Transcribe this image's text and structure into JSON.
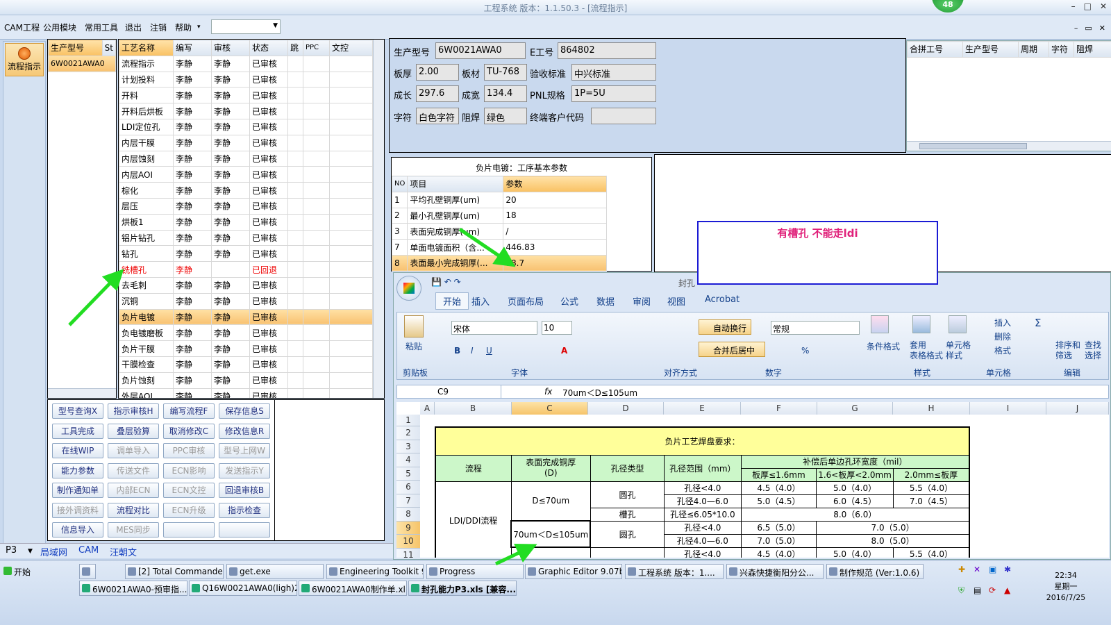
{
  "window": {
    "title": "工程系统  版本：1.1.50.3 - [流程指示]",
    "badge": "48",
    "min": "–",
    "max": "□",
    "close": "✕"
  },
  "menu": {
    "items": [
      "CAM工程",
      "公用模块",
      "常用工具",
      "退出",
      "注销",
      "帮助"
    ],
    "help_arrow": "▾"
  },
  "nav": {
    "button_label": "流程指示"
  },
  "model_list": {
    "headers": [
      "生产型号",
      "St"
    ],
    "rows": [
      "6W0021AWA0"
    ]
  },
  "process_grid": {
    "headers": [
      "工艺名称",
      "编写",
      "审核",
      "状态",
      "跳",
      "PPC",
      "文控"
    ],
    "rows": [
      [
        "流程指示",
        "李静",
        "李静",
        "已审核"
      ],
      [
        "计划投料",
        "李静",
        "李静",
        "已审核"
      ],
      [
        "开料",
        "李静",
        "李静",
        "已审核"
      ],
      [
        "开料后烘板",
        "李静",
        "李静",
        "已审核"
      ],
      [
        "LDI定位孔",
        "李静",
        "李静",
        "已审核"
      ],
      [
        "内层干膜",
        "李静",
        "李静",
        "已审核"
      ],
      [
        "内层蚀刻",
        "李静",
        "李静",
        "已审核"
      ],
      [
        "内层AOI",
        "李静",
        "李静",
        "已审核"
      ],
      [
        "棕化",
        "李静",
        "李静",
        "已审核"
      ],
      [
        "层压",
        "李静",
        "李静",
        "已审核"
      ],
      [
        "烘板1",
        "李静",
        "李静",
        "已审核"
      ],
      [
        "铝片钻孔",
        "李静",
        "李静",
        "已审核"
      ],
      [
        "钻孔",
        "李静",
        "李静",
        "已审核"
      ],
      [
        "铣槽孔",
        "李静",
        "",
        "已回退"
      ],
      [
        "去毛刺",
        "李静",
        "李静",
        "已审核"
      ],
      [
        "沉铜",
        "李静",
        "李静",
        "已审核"
      ],
      [
        "负片电镀",
        "李静",
        "李静",
        "已审核"
      ],
      [
        "负电镀磨板",
        "李静",
        "李静",
        "已审核"
      ],
      [
        "负片干膜",
        "李静",
        "李静",
        "已审核"
      ],
      [
        "干膜检查",
        "李静",
        "李静",
        "已审核"
      ],
      [
        "负片蚀刻",
        "李静",
        "李静",
        "已审核"
      ],
      [
        "外层AOI",
        "李静",
        "李静",
        "已审核"
      ]
    ]
  },
  "buttons": [
    [
      "型号查询X",
      "指示审核H",
      "编写流程F",
      "保存信息S"
    ],
    [
      "工具完成",
      "叠层验算",
      "取消修改C",
      "修改信息R"
    ],
    [
      "在线WIP",
      "调单导入",
      "PPC审核",
      "型号上网W"
    ],
    [
      "能力参数",
      "传送文件",
      "ECN影响",
      "发送指示Y"
    ],
    [
      "制作通知单",
      "内部ECN",
      "ECN文控",
      "回退审核B"
    ],
    [
      "接外调资料",
      "流程对比",
      "ECN升级",
      "指示检查"
    ],
    [
      "信息导入",
      "MES同步",
      "",
      ""
    ]
  ],
  "bottom_tabs": {
    "combo": "P3",
    "tabs": [
      "局域网",
      "CAM",
      "汪朝文"
    ]
  },
  "info": {
    "labels": [
      "生产型号",
      "E工号",
      "板厚",
      "板材",
      "验收标准",
      "成长",
      "成宽",
      "PNL规格",
      "字符",
      "阻焊",
      "终端客户代码"
    ],
    "values": [
      "6W0021AWA0",
      "864802",
      "2.00",
      "TU-768",
      "中兴标准",
      "297.6",
      "134.4",
      "1P=5U",
      "白色字符",
      "绿色",
      ""
    ]
  },
  "merge_grid": {
    "headers": [
      "合拼工号",
      "生产型号",
      "周期",
      "字符",
      "阻焊"
    ]
  },
  "params": {
    "title": "负片电镀：工序基本参数",
    "headers": [
      "NO",
      "项目",
      "参数"
    ],
    "rows": [
      [
        "1",
        "平均孔壁铜厚(um)",
        "20"
      ],
      [
        "2",
        "最小孔壁铜厚(um)",
        "18"
      ],
      [
        "3",
        "表面完成铜厚(um)",
        "/"
      ],
      [
        "7",
        "单面电镀面积（含...",
        "446.83"
      ],
      [
        "8",
        "表面最小完成铜厚(...",
        "78.7"
      ]
    ]
  },
  "note": {
    "text": "有槽孔  不能走ldi"
  },
  "excel": {
    "title": "封孔",
    "tabs": [
      "开始",
      "插入",
      "页面布局",
      "公式",
      "数据",
      "审阅",
      "视图",
      "Acrobat"
    ],
    "paste": "粘贴",
    "font": "宋体",
    "size": "10",
    "format": "常规",
    "wrap": "自动换行",
    "merge": "合并后居中",
    "groups": [
      "剪贴板",
      "字体",
      "对齐方式",
      "数字",
      "样式",
      "单元格",
      "编辑"
    ],
    "style_btns": [
      "条件格式",
      "套用\n表格格式",
      "单元格\n样式"
    ],
    "cell_btns": [
      "插入",
      "删除",
      "格式"
    ],
    "edit_btns": [
      "排序和\n筛选",
      "查找\n选择"
    ],
    "name_box": "C9",
    "fx": "fx",
    "formula": "70um＜D≤105um",
    "cols": [
      "A",
      "B",
      "C",
      "D",
      "E",
      "F",
      "G",
      "H",
      "I",
      "J"
    ],
    "rows": [
      "1",
      "2",
      "3",
      "4",
      "5",
      "6",
      "7",
      "8",
      "9",
      "10",
      "11"
    ],
    "sheet": {
      "title": "负片工艺焊盘要求：",
      "h_flow": "流程",
      "h_surface": "表面完成铜厚\n(D)",
      "h_hole": "孔径类型",
      "h_range": "孔径范围（mm）",
      "h_comp": "补偿后单边孔环宽度（mil）",
      "sub": [
        "板厚≤1.6mm",
        "1.6<板厚<2.0mm",
        "2.0mm≤板厚"
      ],
      "flow": "LDI/DDI流程",
      "d1": "D≤70um",
      "d2": "70um＜D≤105um",
      "round": "圆孔",
      "slot": "槽孔",
      "r6": [
        "孔径<4.0",
        "4.5（4.0）",
        "5.0（4.0）",
        "5.5（4.0）"
      ],
      "r7": [
        "孔径4.0—6.0",
        "5.0（4.5）",
        "6.0（4.5）",
        "7.0（4.5）"
      ],
      "r8": [
        "孔径≤6.05*10.0",
        "8.0（6.0）"
      ],
      "r9": [
        "孔径<4.0",
        "6.5（5.0）",
        "7.0（5.0）"
      ],
      "r10": [
        "孔径4.0—6.0",
        "7.0（5.0）",
        "8.0（5.0）"
      ],
      "r11": [
        "孔径<4.0",
        "4.5（4.0）",
        "5.0（4.0）",
        "5.5（4.0）"
      ]
    }
  },
  "taskbar": {
    "start": "开始",
    "row1": [
      "",
      "[2] Total Commander ...",
      "get.exe",
      "Engineering Toolkit 9....",
      "Progress",
      "Graphic Editor 9.07b2...",
      "工程系统  版本：1....",
      "兴森快捷衡阳分公...",
      "制作规范 (Ver:1.0.6)"
    ],
    "row2": [
      "6W0021AWA0-预审指...",
      "Q16W0021AWA0(ligh)20...",
      "6W0021AWA0制作单.xl...",
      "封孔能力P3.xls [兼容..."
    ],
    "time": "22:34",
    "weekday": "星期一",
    "date": "2016/7/25"
  },
  "colors": {
    "accent": "#f8c272",
    "arrow": "#22dd22",
    "note_border": "#1b1bd4",
    "note_text": "#e0207a"
  }
}
